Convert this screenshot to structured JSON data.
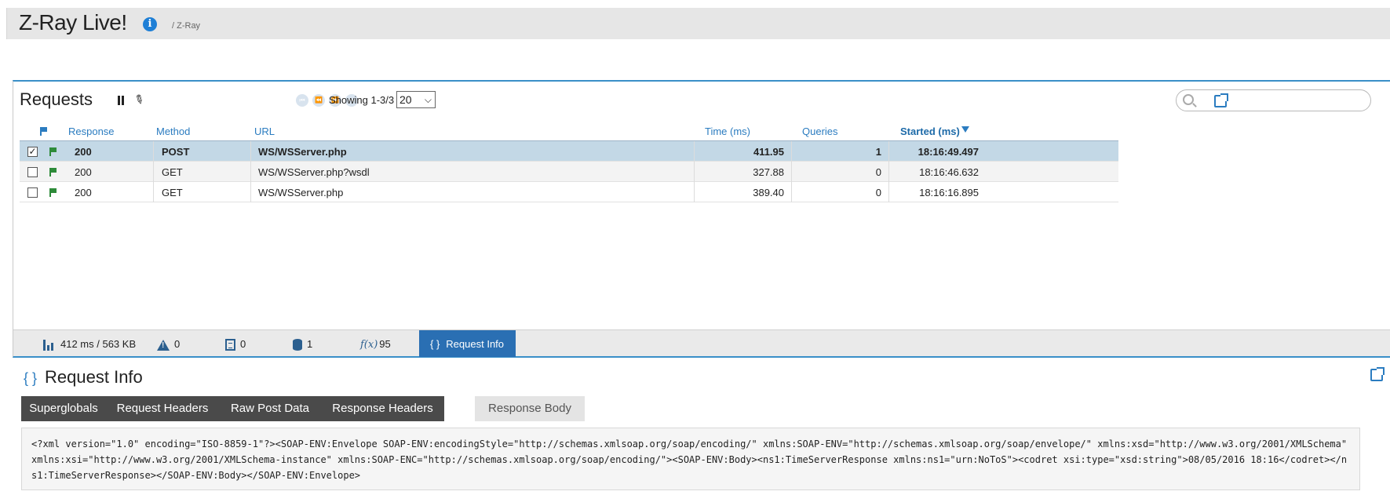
{
  "header": {
    "title": "Z-Ray Live!",
    "breadcrumb": "/ Z-Ray"
  },
  "requests": {
    "title": "Requests",
    "pager": {
      "showing": "Showing 1-3/3",
      "page_size": "20"
    },
    "search": {
      "placeholder": ""
    },
    "columns": [
      "Response",
      "Method",
      "URL",
      "Time (ms)",
      "Queries",
      "Started (ms)"
    ],
    "sorted_column": "Started (ms)",
    "rows": [
      {
        "checked": true,
        "response": "200",
        "method": "POST",
        "url": "WS/WSServer.php",
        "time": "411.95",
        "queries": "1",
        "started": "18:16:49.497"
      },
      {
        "checked": false,
        "response": "200",
        "method": "GET",
        "url": "WS/WSServer.php?wsdl",
        "time": "327.88",
        "queries": "0",
        "started": "18:16:46.632"
      },
      {
        "checked": false,
        "response": "200",
        "method": "GET",
        "url": "WS/WSServer.php",
        "time": "389.40",
        "queries": "0",
        "started": "18:16:16.895"
      }
    ]
  },
  "toolbar": {
    "timing": "412 ms / 563 KB",
    "errors": "0",
    "logs": "0",
    "queries": "1",
    "functions": "95",
    "fx_label": "f(x)",
    "active_tab": "Request Info"
  },
  "request_info": {
    "title": "Request Info",
    "tabs": [
      "Superglobals",
      "Request Headers",
      "Raw Post Data",
      "Response Headers",
      "Response Body"
    ],
    "active_tab": "Response Body",
    "body": "<?xml version=\"1.0\" encoding=\"ISO-8859-1\"?><SOAP-ENV:Envelope SOAP-ENV:encodingStyle=\"http://schemas.xmlsoap.org/soap/encoding/\" xmlns:SOAP-ENV=\"http://schemas.xmlsoap.org/soap/envelope/\" xmlns:xsd=\"http://www.w3.org/2001/XMLSchema\" xmlns:xsi=\"http://www.w3.org/2001/XMLSchema-instance\" xmlns:SOAP-ENC=\"http://schemas.xmlsoap.org/soap/encoding/\"><SOAP-ENV:Body><ns1:TimeServerResponse xmlns:ns1=\"urn:NoToS\"><codret xsi:type=\"xsd:string\">08/05/2016 18:16</codret></ns1:TimeServerResponse></SOAP-ENV:Body></SOAP-ENV:Envelope>"
  },
  "colors": {
    "accent": "#2b7cc0",
    "active_tab_bg": "#2a6fb3",
    "selected_row": "#c3d8e6",
    "flag_green": "#2e8b3a"
  }
}
